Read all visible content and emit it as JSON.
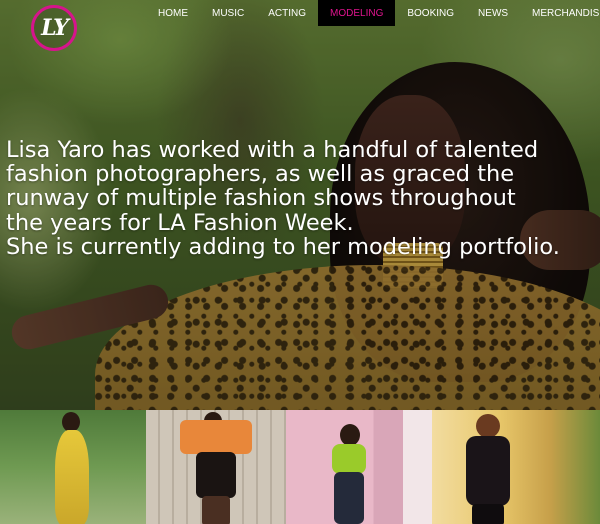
{
  "logo": {
    "text": "LY"
  },
  "nav": {
    "items": [
      "HOME",
      "MUSIC",
      "ACTING",
      "MODELING",
      "BOOKING",
      "NEWS",
      "MERCHANDISE"
    ],
    "active": "MODELING"
  },
  "hero": {
    "lines": [
      "Lisa Yaro has worked with a handful of talented",
      "fashion photographers, as well as graced the",
      "runway of multiple fashion shows throughout",
      "the years for LA Fashion Week.",
      "She is currently adding to her modeling portfolio."
    ]
  },
  "colors": {
    "accent": "#d6148c",
    "nav_active_bg": "#000000"
  }
}
